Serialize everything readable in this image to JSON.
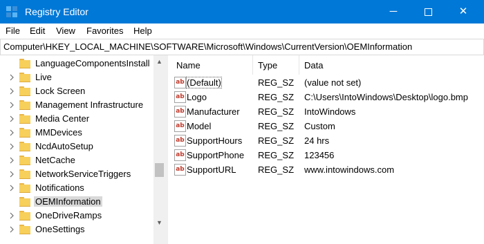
{
  "window": {
    "title": "Registry Editor",
    "icon": "registry-editor-icon",
    "controls": {
      "minimize": "─",
      "close": "✕"
    }
  },
  "menu": [
    "File",
    "Edit",
    "View",
    "Favorites",
    "Help"
  ],
  "address": "Computer\\HKEY_LOCAL_MACHINE\\SOFTWARE\\Microsoft\\Windows\\CurrentVersion\\OEMInformation",
  "tree": {
    "items": [
      "LanguageComponentsInstall",
      "Live",
      "Lock Screen",
      "Management Infrastructure",
      "Media Center",
      "MMDevices",
      "NcdAutoSetup",
      "NetCache",
      "NetworkServiceTriggers",
      "Notifications",
      "OEMInformation",
      "OneDriveRamps",
      "OneSettings"
    ],
    "selected": "OEMInformation"
  },
  "values": {
    "columns": {
      "name": "Name",
      "type": "Type",
      "data": "Data"
    },
    "rows": [
      {
        "name": "(Default)",
        "type": "REG_SZ",
        "data": "(value not set)"
      },
      {
        "name": "Logo",
        "type": "REG_SZ",
        "data": "C:\\Users\\IntoWindows\\Desktop\\logo.bmp"
      },
      {
        "name": "Manufacturer",
        "type": "REG_SZ",
        "data": "IntoWindows"
      },
      {
        "name": "Model",
        "type": "REG_SZ",
        "data": "Custom"
      },
      {
        "name": "SupportHours",
        "type": "REG_SZ",
        "data": "24 hrs"
      },
      {
        "name": "SupportPhone",
        "type": "REG_SZ",
        "data": "123456"
      },
      {
        "name": "SupportURL",
        "type": "REG_SZ",
        "data": "www.intowindows.com"
      }
    ],
    "icon": "string-value-icon"
  },
  "colors": {
    "titlebar": "#0078d7",
    "folder": "#f7cf5b",
    "selection": "#d9d9d9"
  }
}
